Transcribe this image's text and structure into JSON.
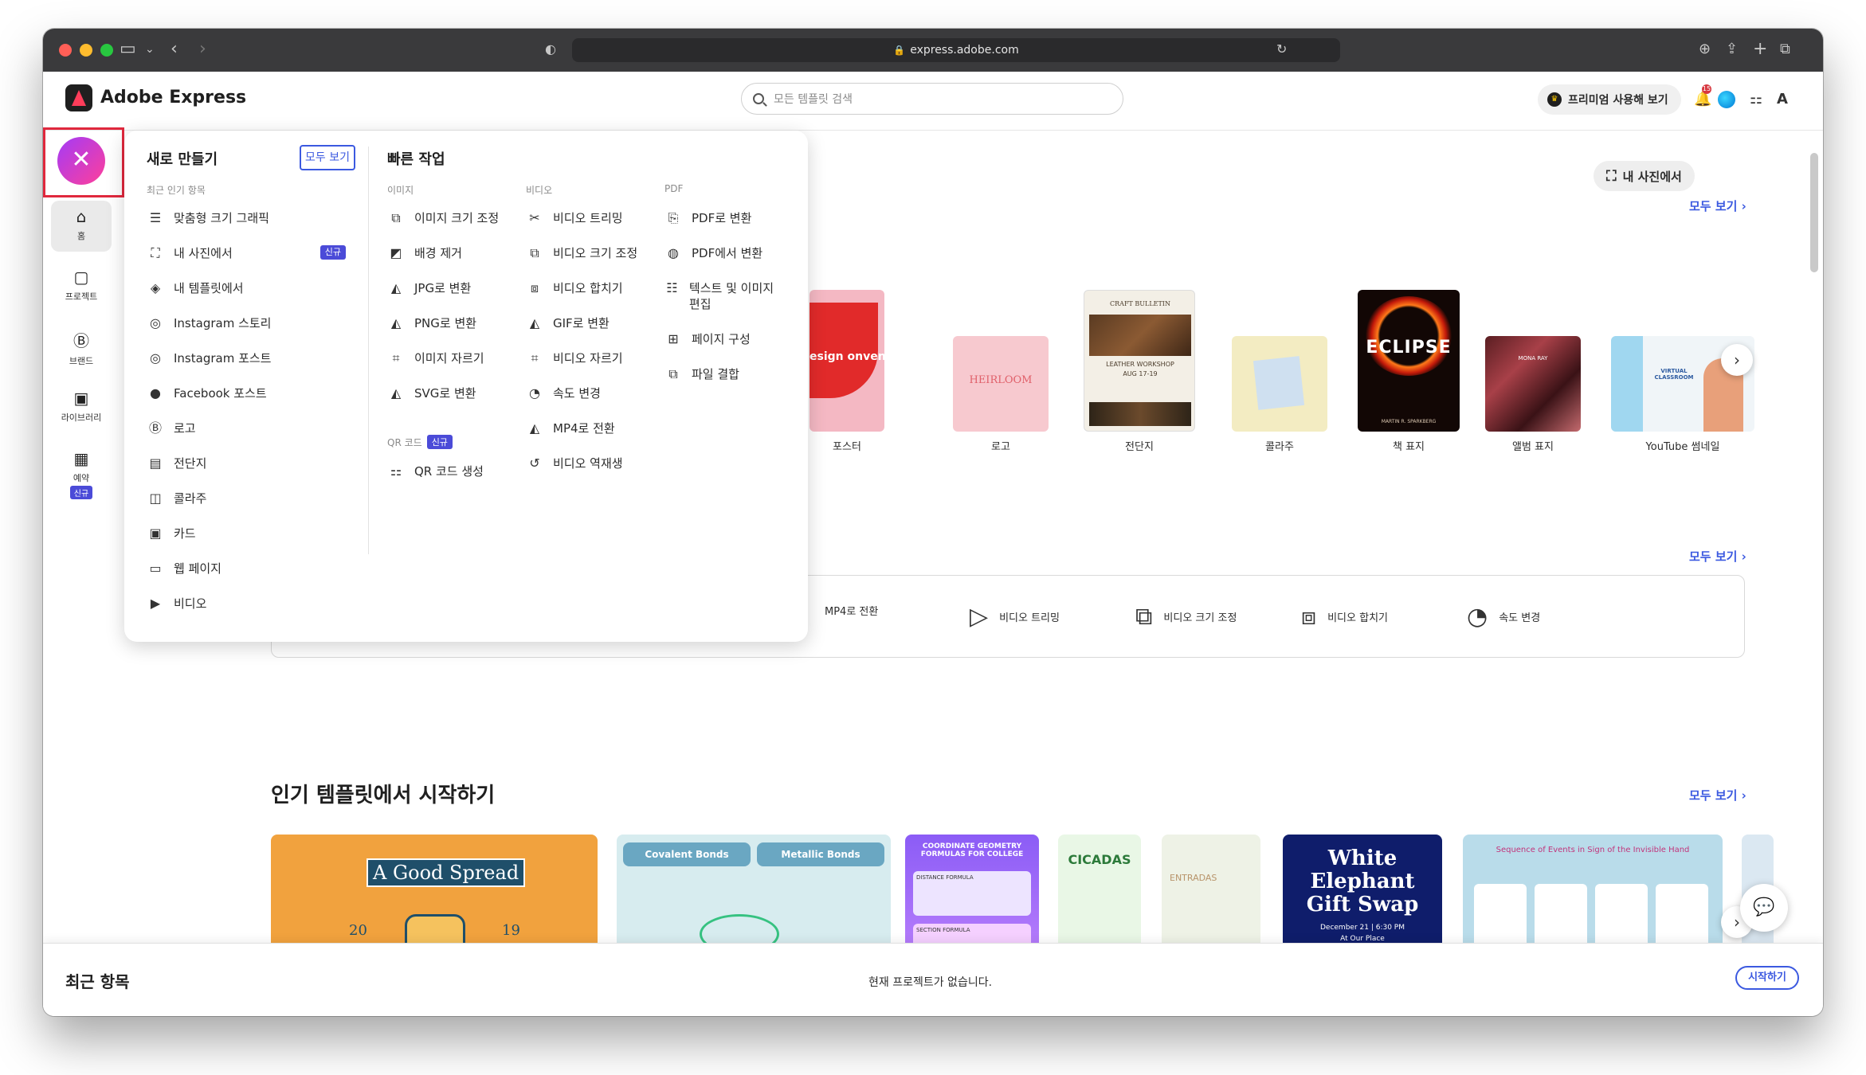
{
  "browser": {
    "url": "express.adobe.com"
  },
  "app": {
    "brand": "Adobe Express",
    "search_placeholder": "모든 템플릿 검색",
    "premium_label": "프리미엄 사용해 보기",
    "notification_count": "15"
  },
  "rail": {
    "items": [
      {
        "label": "홈",
        "icon": "home-icon"
      },
      {
        "label": "프로젝트",
        "icon": "folder-icon"
      },
      {
        "label": "브랜드",
        "icon": "brand-icon"
      },
      {
        "label": "라이브러리",
        "icon": "library-icon"
      },
      {
        "label": "예약",
        "icon": "calendar-icon",
        "badge": "신규"
      }
    ]
  },
  "main": {
    "my_photo_button": "내 사진에서",
    "see_all": "모두 보기 ›",
    "templates_row": [
      {
        "label": "포스터"
      },
      {
        "label": "로고"
      },
      {
        "label": "전단지"
      },
      {
        "label": "콜라주"
      },
      {
        "label": "책 표지"
      },
      {
        "label": "앨범 표지"
      },
      {
        "label": "YouTube 썸네일"
      }
    ],
    "thumb_text": {
      "poster": "esign onvention",
      "logo": "HEIRLOOM",
      "flyer_header": "CRAFT BULLETIN",
      "flyer_title": "LEATHER WORKSHOP",
      "flyer_date": "AUG 17-19",
      "book_title": "ECLIPSE",
      "book_author": "MARTIN R. SPARKBERG",
      "album_title": "MONA RAY",
      "youtube_title": "VIRTUAL CLASSROOM"
    },
    "quick_actions": [
      {
        "label": "MP4로 전환",
        "icon": "convert-mp4-icon"
      },
      {
        "label": "비디오 트리밍",
        "icon": "trim-video-icon"
      },
      {
        "label": "비디오 크기 조정",
        "icon": "resize-video-icon"
      },
      {
        "label": "비디오 합치기",
        "icon": "merge-video-icon"
      },
      {
        "label": "속도 변경",
        "icon": "speed-icon"
      }
    ],
    "popular_title": "인기 템플릿에서 시작하기",
    "popular_templates": {
      "t1_title": "A Good Spread",
      "t1_left": "20",
      "t1_right": "19",
      "t2_left": "Covalent Bonds",
      "t2_right": "Metallic Bonds",
      "t3_title": "COORDINATE GEOMETRY FORMULAS FOR COLLEGE",
      "t3_sub1": "DISTANCE FORMULA",
      "t3_sub2": "SECTION FORMULA",
      "t4_title": "CICADAS",
      "t5_title": "ENTRADAS",
      "t6_line1": "White",
      "t6_line2": "Elephant",
      "t6_line3": "Gift Swap",
      "t6_date": "December 21 | 6:30 PM",
      "t6_place": "At Our Place",
      "t7_title": "Sequence of Events in Sign of the Invisible Hand"
    }
  },
  "recent": {
    "title": "최근 항목",
    "empty": "현재 프로젝트가 없습니다.",
    "start": "시작하기"
  },
  "menu": {
    "create_title": "새로 만들기",
    "create_see_all": "모두 보기",
    "create_sub": "최근 인기 항목",
    "create_items": [
      {
        "label": "맞춤형 크기 그래픽",
        "icon": "sliders-icon"
      },
      {
        "label": "내 사진에서",
        "icon": "photo-icon",
        "badge": "신규"
      },
      {
        "label": "내 템플릿에서",
        "icon": "template-icon"
      },
      {
        "label": "Instagram 스토리",
        "icon": "instagram-icon"
      },
      {
        "label": "Instagram 포스트",
        "icon": "instagram-icon"
      },
      {
        "label": "Facebook 포스트",
        "icon": "facebook-icon"
      },
      {
        "label": "로고",
        "icon": "logo-icon"
      },
      {
        "label": "전단지",
        "icon": "flyer-icon"
      },
      {
        "label": "콜라주",
        "icon": "collage-icon"
      },
      {
        "label": "카드",
        "icon": "card-icon"
      },
      {
        "label": "웹 페이지",
        "icon": "webpage-icon"
      },
      {
        "label": "비디오",
        "icon": "video-icon"
      }
    ],
    "quick_title": "빠른 작업",
    "image_sub": "이미지",
    "image_items": [
      {
        "label": "이미지 크기 조정",
        "icon": "resize-image-icon"
      },
      {
        "label": "배경 제거",
        "icon": "remove-bg-icon"
      },
      {
        "label": "JPG로 변환",
        "icon": "convert-jpg-icon"
      },
      {
        "label": "PNG로 변환",
        "icon": "convert-png-icon"
      },
      {
        "label": "이미지 자르기",
        "icon": "crop-icon"
      },
      {
        "label": "SVG로 변환",
        "icon": "convert-svg-icon"
      }
    ],
    "qr_sub": "QR 코드",
    "qr_badge": "신규",
    "qr_items": [
      {
        "label": "QR 코드 생성",
        "icon": "qr-icon"
      }
    ],
    "video_sub": "비디오",
    "video_items": [
      {
        "label": "비디오 트리밍",
        "icon": "trim-icon"
      },
      {
        "label": "비디오 크기 조정",
        "icon": "resize-video-icon"
      },
      {
        "label": "비디오 합치기",
        "icon": "merge-icon"
      },
      {
        "label": "GIF로 변환",
        "icon": "convert-gif-icon"
      },
      {
        "label": "비디오 자르기",
        "icon": "crop-video-icon"
      },
      {
        "label": "속도 변경",
        "icon": "speed-icon"
      },
      {
        "label": "MP4로 전환",
        "icon": "convert-mp4-icon"
      },
      {
        "label": "비디오 역재생",
        "icon": "reverse-icon"
      }
    ],
    "pdf_sub": "PDF",
    "pdf_items": [
      {
        "label": "PDF로 변환",
        "icon": "to-pdf-icon"
      },
      {
        "label": "PDF에서 변환",
        "icon": "from-pdf-icon"
      },
      {
        "label": "텍스트 및 이미지 편집",
        "icon": "edit-pdf-icon"
      },
      {
        "label": "페이지 구성",
        "icon": "organize-pages-icon"
      },
      {
        "label": "파일 결합",
        "icon": "combine-icon"
      }
    ]
  },
  "colors": {
    "accent": "#3b59e0",
    "new_badge": "#4b4bd8",
    "highlight": "#e0283d"
  }
}
